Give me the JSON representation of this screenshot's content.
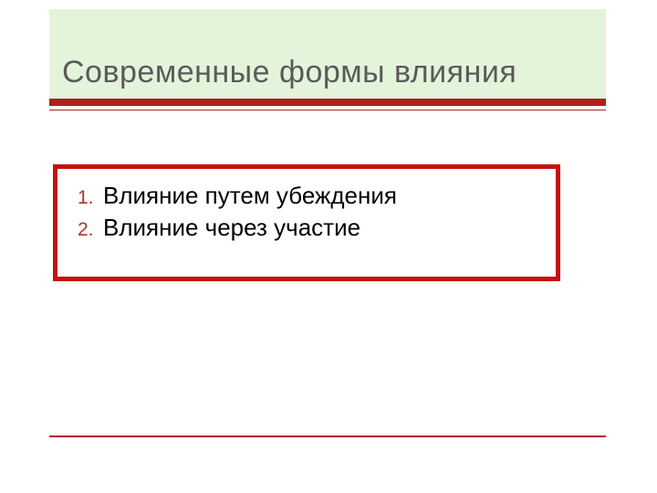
{
  "slide": {
    "title": "Современные формы влияния",
    "items": [
      {
        "number": "1.",
        "text": "Влияние путем убеждения"
      },
      {
        "number": "2.",
        "text": "Влияние через участие"
      }
    ]
  },
  "colors": {
    "header_bg": "#e3f4db",
    "accent": "#b01e1e",
    "box_border": "#c71010",
    "title_color": "#5a5a5a",
    "number_color": "#a93822"
  }
}
